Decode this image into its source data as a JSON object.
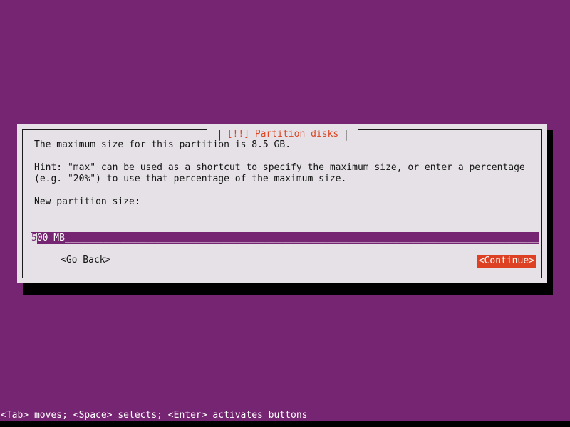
{
  "screen": {
    "background_color": "#762572",
    "shadow_color": "#000000"
  },
  "dialog": {
    "title": "[!!] Partition disks",
    "title_color": "#dd4522",
    "background_color": "#e5e1e6",
    "border_color": "#1a1a1a",
    "title_separator": "|",
    "body": {
      "line1": "The maximum size for this partition is 8.5 GB.",
      "hint_line1": "Hint: \"max\" can be used as a shortcut to specify the maximum size, or enter a percentage",
      "hint_line2": "(e.g. \"20%\") to use that percentage of the maximum size.",
      "prompt_label": "New partition size:"
    },
    "input": {
      "cursor_char": "5",
      "value_rest": "00 MB",
      "value_full": "500 MB",
      "fill_char": "_",
      "fill": "_________________________________________________________________________________________________________",
      "background_color": "#762572",
      "text_color": "#ffffff"
    },
    "buttons": {
      "go_back": "<Go Back>",
      "continue": "<Continue>",
      "continue_highlight_color": "#dd4022",
      "continue_text_color": "#ffffff"
    }
  },
  "statusbar": {
    "text": "<Tab> moves; <Space> selects; <Enter> activates buttons",
    "text_color": "#ffffff"
  }
}
